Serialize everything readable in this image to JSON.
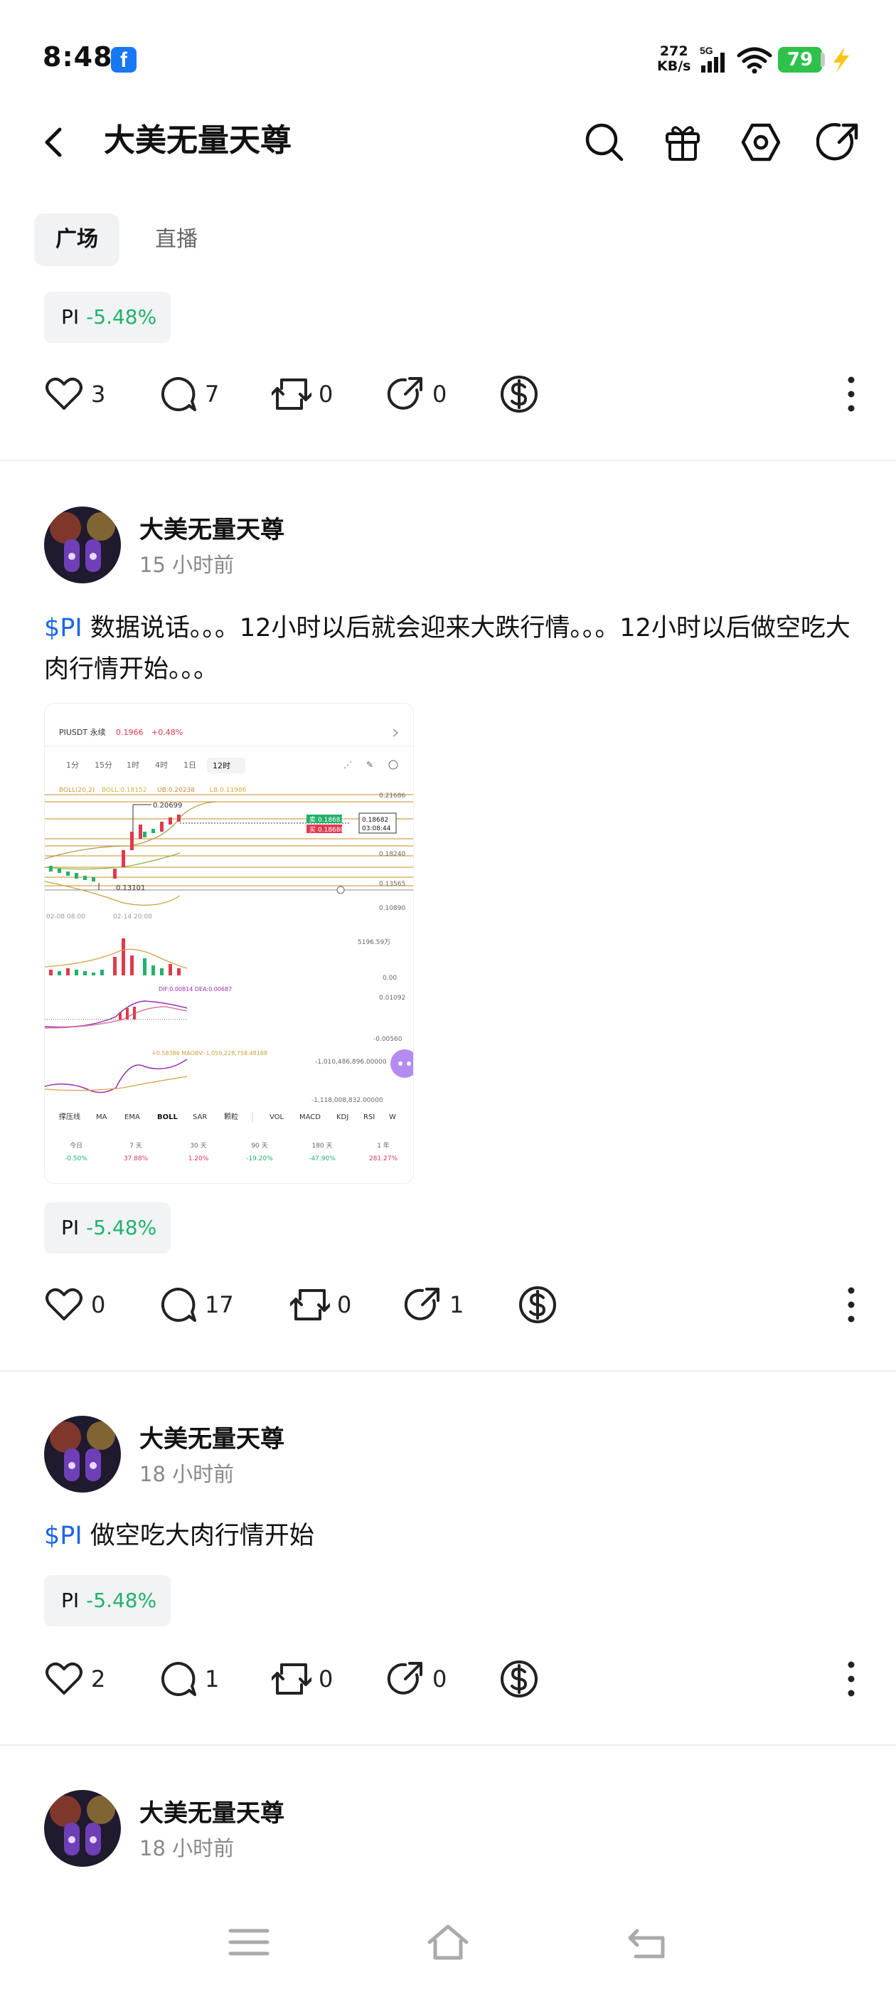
{
  "status_bar": {
    "time": "8:48",
    "app_badge": "f",
    "net_speed_value": "272",
    "net_speed_unit": "KB/s",
    "network": "5G",
    "battery": "79"
  },
  "header": {
    "title": "大美无量天尊",
    "icons": [
      "search-icon",
      "gift-icon",
      "settings-icon",
      "share-icon"
    ]
  },
  "tabs": [
    {
      "label": "广场",
      "active": true
    },
    {
      "label": "直播",
      "active": false
    }
  ],
  "posts": [
    {
      "tag": {
        "symbol": "PI",
        "change": "-5.48%"
      },
      "actions": {
        "likes": "3",
        "comments": "7",
        "reposts": "0",
        "shares": "0"
      }
    },
    {
      "author": "大美无量天尊",
      "time": "15 小时前",
      "cashtag": "$PI",
      "text": " 数据说话。。。12小时以后就会迎来大跌行情。。。12小时以后做空吃大肉行情开始。。。",
      "image": {
        "pair": "PIUSDT 永续",
        "price": "0.1966",
        "price_change": "+0.48%",
        "intervals": [
          "1分",
          "15分",
          "1时",
          "4时",
          "1日",
          "12时"
        ],
        "boll_label": "BOLL(20,2)",
        "boll": "BOLL:0.18152",
        "ub": "UB:0.20238",
        "lb": "LB:0.11986",
        "high": "0.20699",
        "low": "0.13101",
        "ask": "0.18687",
        "bid": "0.18680",
        "current": "0.18682",
        "countdown": "03:08:44",
        "right_axis": [
          "0.21686",
          "0.18240",
          "0.13565",
          "0.10890"
        ],
        "dates": [
          "02-08 08:00",
          "02-14 20:00"
        ],
        "vol_axis": [
          "5196.59万",
          "0.00"
        ],
        "macd_label": "DIF:0.00814  DEA:0.00687",
        "macd_axis": [
          "0.01092",
          "-0.00560"
        ],
        "obv_label": "+0.58386  MAOBV:-1,059,228,758.48188",
        "obv_axis": [
          "-1,010,486,896.00000",
          "-1,118,008,832.00000"
        ],
        "indicators": [
          "撑压线",
          "MA",
          "EMA",
          "BOLL",
          "SAR",
          "颗粒",
          "VOL",
          "MACD",
          "KDJ",
          "RSI",
          "W"
        ],
        "periods": [
          {
            "label": "今日",
            "value": "-0.50%"
          },
          {
            "label": "7 天",
            "value": "37.88%"
          },
          {
            "label": "30 天",
            "value": "1.20%"
          },
          {
            "label": "90 天",
            "value": "-19.20%"
          },
          {
            "label": "180 天",
            "value": "-47.90%"
          },
          {
            "label": "1 年",
            "value": "281.27%"
          }
        ]
      },
      "tag": {
        "symbol": "PI",
        "change": "-5.48%"
      },
      "actions": {
        "likes": "0",
        "comments": "17",
        "reposts": "0",
        "shares": "1"
      }
    },
    {
      "author": "大美无量天尊",
      "time": "18 小时前",
      "cashtag": "$PI",
      "text": " 做空吃大肉行情开始",
      "tag": {
        "symbol": "PI",
        "change": "-5.48%"
      },
      "actions": {
        "likes": "2",
        "comments": "1",
        "reposts": "0",
        "shares": "0"
      }
    },
    {
      "author": "大美无量天尊",
      "time": "18 小时前"
    }
  ],
  "colors": {
    "positive": "#20b26c",
    "cashtag": "#1a66e6",
    "battery": "#2ec24a"
  }
}
